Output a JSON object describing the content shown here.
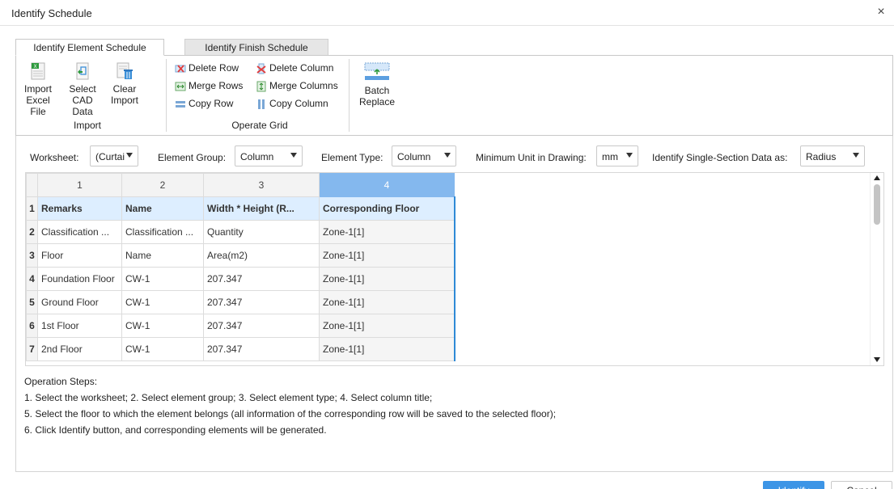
{
  "window": {
    "title": "Identify Schedule",
    "close_glyph": "×"
  },
  "tabs": [
    {
      "label": "Identify Element Schedule",
      "active": true
    },
    {
      "label": "Identify Finish Schedule",
      "active": false
    }
  ],
  "ribbon": {
    "import_group": {
      "label": "Import",
      "buttons": [
        {
          "line1": "Import",
          "line2": "Excel File",
          "icon": "excel-file-icon"
        },
        {
          "line1": "Select",
          "line2": "CAD Data",
          "icon": "cad-data-icon"
        },
        {
          "line1": "Clear",
          "line2": "Import",
          "icon": "clear-import-icon"
        }
      ]
    },
    "operate_group": {
      "label": "Operate Grid",
      "items": [
        {
          "label": "Delete Row",
          "icon": "delete-row-icon"
        },
        {
          "label": "Delete Column",
          "icon": "delete-column-icon"
        },
        {
          "label": "Merge Rows",
          "icon": "merge-rows-icon"
        },
        {
          "label": "Merge Columns",
          "icon": "merge-columns-icon"
        },
        {
          "label": "Copy Row",
          "icon": "copy-row-icon"
        },
        {
          "label": "Copy Column",
          "icon": "copy-column-icon"
        }
      ]
    },
    "batch_replace": {
      "line1": "Batch",
      "line2": "Replace",
      "icon": "batch-replace-icon"
    }
  },
  "filters": {
    "worksheet": {
      "label": "Worksheet:",
      "value": "(Curtai"
    },
    "element_group": {
      "label": "Element Group:",
      "value": "Column"
    },
    "element_type": {
      "label": "Element Type:",
      "value": "Column"
    },
    "min_unit": {
      "label": "Minimum Unit in Drawing:",
      "value": "mm"
    },
    "single_section": {
      "label": "Identify Single-Section Data as:",
      "value": "Radius"
    }
  },
  "grid": {
    "column_numbers": [
      "1",
      "2",
      "3",
      "4"
    ],
    "selected_column": "4",
    "header_row": {
      "num": "1",
      "cells": [
        "Remarks",
        "Name",
        "Width * Height (R...",
        "Corresponding Floor"
      ]
    },
    "rows": [
      {
        "num": "2",
        "cells": [
          "Classification ...",
          "Classification ...",
          "Quantity",
          "Zone-1[1]"
        ]
      },
      {
        "num": "3",
        "cells": [
          "Floor",
          "Name",
          "Area(m2)",
          "Zone-1[1]"
        ]
      },
      {
        "num": "4",
        "cells": [
          "Foundation Floor",
          "CW-1",
          "207.347",
          "Zone-1[1]"
        ]
      },
      {
        "num": "5",
        "cells": [
          "Ground Floor",
          "CW-1",
          "207.347",
          "Zone-1[1]"
        ]
      },
      {
        "num": "6",
        "cells": [
          "1st Floor",
          "CW-1",
          "207.347",
          "Zone-1[1]"
        ]
      },
      {
        "num": "7",
        "cells": [
          "2nd Floor",
          "CW-1",
          "207.347",
          "Zone-1[1]"
        ]
      }
    ]
  },
  "steps": {
    "title": "Operation Steps:",
    "lines": [
      "1. Select the worksheet; 2. Select element group; 3. Select element type; 4. Select column title;",
      "5. Select the floor to which the element belongs (all information of the corresponding row will be saved to the selected floor);",
      "6. Click Identify button, and corresponding elements will be generated."
    ]
  },
  "actions": {
    "identify": "Identify",
    "cancel": "Cancel"
  },
  "colors": {
    "accent": "#3d95e6",
    "selected_header": "#84b8ee",
    "title_row_bg": "#ddeeff",
    "col_border": "#2f8ad6"
  }
}
